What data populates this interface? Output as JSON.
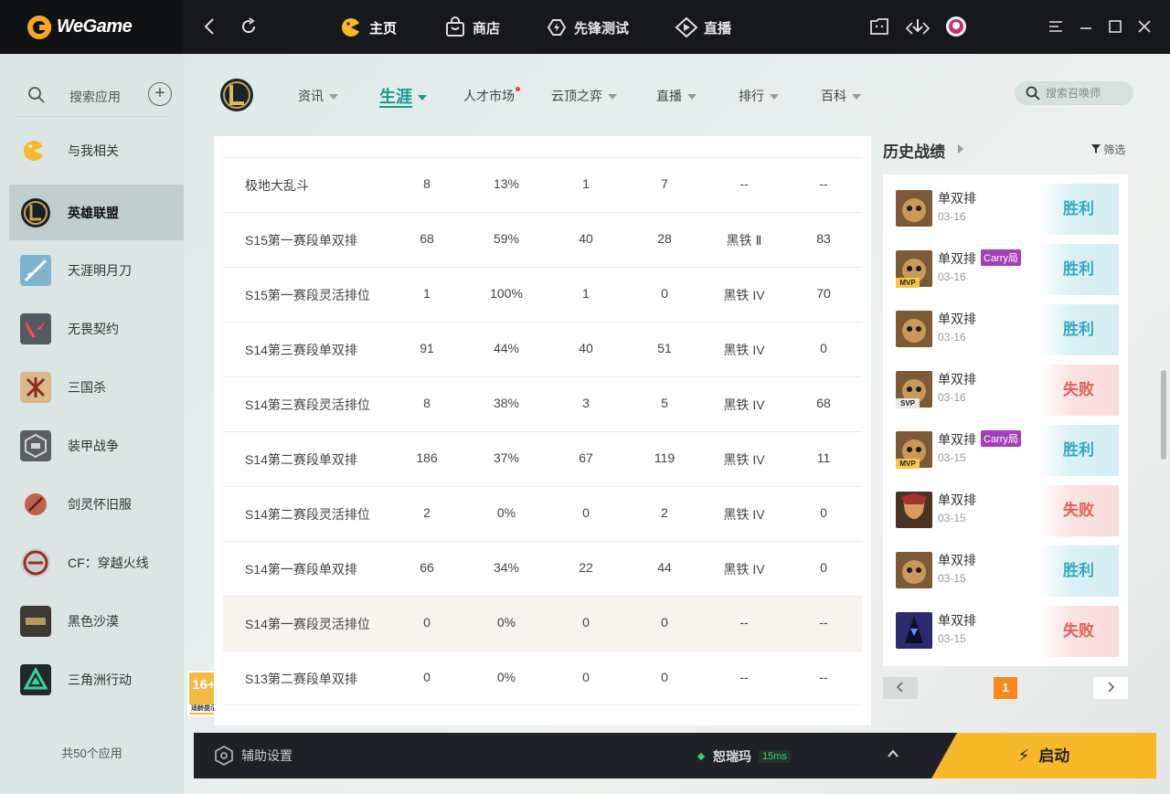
{
  "app": {
    "name": "WeGame"
  },
  "topnav": [
    {
      "label": "主页"
    },
    {
      "label": "商店"
    },
    {
      "label": "先锋测试"
    },
    {
      "label": "直播"
    }
  ],
  "sidebar": {
    "search_label": "搜索应用",
    "items": [
      {
        "label": "与我相关"
      },
      {
        "label": "英雄联盟"
      },
      {
        "label": "天涯明月刀"
      },
      {
        "label": "无畏契约"
      },
      {
        "label": "三国杀"
      },
      {
        "label": "装甲战争"
      },
      {
        "label": "剑灵怀旧服"
      },
      {
        "label": "CF：穿越火线"
      },
      {
        "label": "黑色沙漠"
      },
      {
        "label": "三角洲行动"
      }
    ],
    "footer": "共50个应用",
    "age_rating": "16+",
    "age_sub": "适龄提示"
  },
  "subnav": [
    {
      "label": "资讯"
    },
    {
      "label": "生涯"
    },
    {
      "label": "人才市场"
    },
    {
      "label": "云顶之弈"
    },
    {
      "label": "直播"
    },
    {
      "label": "排行"
    },
    {
      "label": "百科"
    }
  ],
  "summoner_search_placeholder": "搜索召唤师",
  "stats_rows": [
    [
      "极地大乱斗",
      "8",
      "13%",
      "1",
      "7",
      "--",
      "--"
    ],
    [
      "S15第一赛段单双排",
      "68",
      "59%",
      "40",
      "28",
      "黑铁 Ⅱ",
      "83"
    ],
    [
      "S15第一赛段灵活排位",
      "1",
      "100%",
      "1",
      "0",
      "黑铁 IV",
      "70"
    ],
    [
      "S14第三赛段单双排",
      "91",
      "44%",
      "40",
      "51",
      "黑铁 IV",
      "0"
    ],
    [
      "S14第三赛段灵活排位",
      "8",
      "38%",
      "3",
      "5",
      "黑铁 IV",
      "68"
    ],
    [
      "S14第二赛段单双排",
      "186",
      "37%",
      "67",
      "119",
      "黑铁 IV",
      "11"
    ],
    [
      "S14第二赛段灵活排位",
      "2",
      "0%",
      "0",
      "2",
      "黑铁 IV",
      "0"
    ],
    [
      "S14第一赛段单双排",
      "66",
      "34%",
      "22",
      "44",
      "黑铁 IV",
      "0"
    ],
    [
      "S14第一赛段灵活排位",
      "0",
      "0%",
      "0",
      "0",
      "--",
      "--"
    ],
    [
      "S13第二赛段单双排",
      "0",
      "0%",
      "0",
      "0",
      "--",
      "--"
    ]
  ],
  "history": {
    "title": "历史战绩",
    "filter_label": "筛选",
    "matches": [
      {
        "type": "单双排",
        "date": "03-16",
        "result": "胜利",
        "win": true,
        "badge": "",
        "carry": ""
      },
      {
        "type": "单双排",
        "date": "03-16",
        "result": "胜利",
        "win": true,
        "badge": "MVP",
        "carry": "Carry局"
      },
      {
        "type": "单双排",
        "date": "03-16",
        "result": "胜利",
        "win": true,
        "badge": "",
        "carry": ""
      },
      {
        "type": "单双排",
        "date": "03-16",
        "result": "失败",
        "win": false,
        "badge": "SVP",
        "carry": ""
      },
      {
        "type": "单双排",
        "date": "03-15",
        "result": "胜利",
        "win": true,
        "badge": "MVP",
        "carry": "Carry局"
      },
      {
        "type": "单双排",
        "date": "03-15",
        "result": "失败",
        "win": false,
        "badge": "",
        "carry": ""
      },
      {
        "type": "单双排",
        "date": "03-15",
        "result": "胜利",
        "win": true,
        "badge": "",
        "carry": ""
      },
      {
        "type": "单双排",
        "date": "03-15",
        "result": "失败",
        "win": false,
        "badge": "",
        "carry": ""
      }
    ],
    "page": "1"
  },
  "bottom": {
    "assist_label": "辅助设置",
    "server_name": "恕瑞玛",
    "ping": "15ms",
    "launch_label": "启动"
  },
  "colors": {
    "accent_teal": "#1a9a92",
    "win": "#35a8c0",
    "loss": "#e0605a",
    "launch": "#f7b928"
  }
}
